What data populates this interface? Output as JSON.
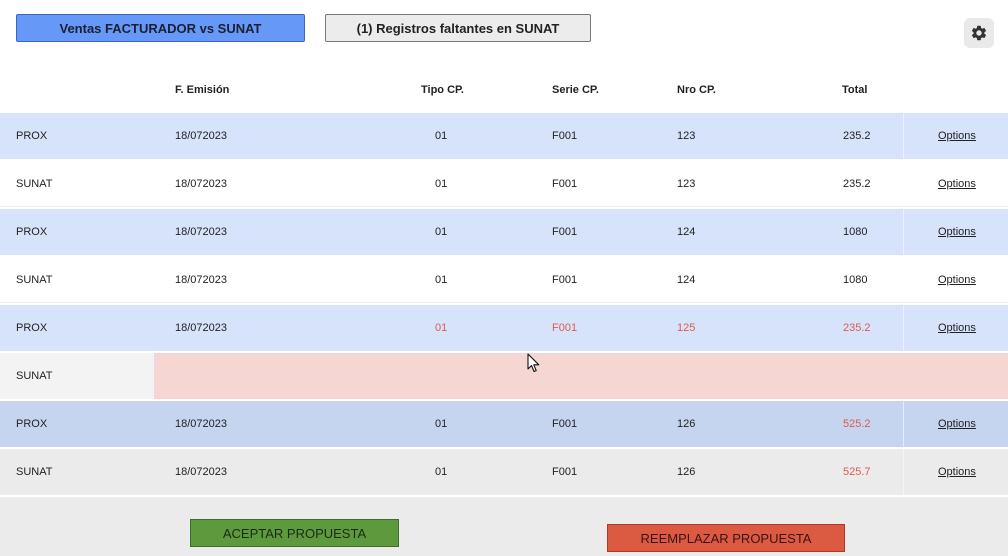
{
  "tabs": {
    "active_label": "Ventas FACTURADOR vs SUNAT",
    "missing_label": "(1) Registros faltantes en SUNAT"
  },
  "settings_icon": "gear-icon",
  "columns": {
    "source": "",
    "fecha": "F. Emisión",
    "tipo": "Tipo CP.",
    "serie": "Serie CP.",
    "nro": "Nro CP.",
    "total": "Total",
    "options": ""
  },
  "rows": [
    {
      "source": "PROX",
      "fecha": "18/072023",
      "tipo": "01",
      "serie": "F001",
      "nro": "123",
      "total": "235.2",
      "options": "Options",
      "style": "blue",
      "red_fields": []
    },
    {
      "source": "SUNAT",
      "fecha": "18/072023",
      "tipo": "01",
      "serie": "F001",
      "nro": "123",
      "total": "235.2",
      "options": "Options",
      "style": "white",
      "red_fields": []
    },
    {
      "source": "PROX",
      "fecha": "18/072023",
      "tipo": "01",
      "serie": "F001",
      "nro": "124",
      "total": "1080",
      "options": "Options",
      "style": "blue",
      "red_fields": []
    },
    {
      "source": "SUNAT",
      "fecha": "18/072023",
      "tipo": "01",
      "serie": "F001",
      "nro": "124",
      "total": "1080",
      "options": "Options",
      "style": "white",
      "red_fields": []
    },
    {
      "source": "PROX",
      "fecha": "18/072023",
      "tipo": "01",
      "serie": "F001",
      "nro": "125",
      "total": "235.2",
      "options": "Options",
      "style": "blue",
      "red_fields": [
        "tipo",
        "serie",
        "nro",
        "total"
      ]
    },
    {
      "source": "SUNAT",
      "fecha": "",
      "tipo": "",
      "serie": "",
      "nro": "",
      "total": "",
      "options": "",
      "style": "missing",
      "red_fields": []
    },
    {
      "source": "PROX",
      "fecha": "18/072023",
      "tipo": "01",
      "serie": "F001",
      "nro": "126",
      "total": "525.2",
      "options": "Options",
      "style": "blue-dark",
      "red_fields": [
        "total"
      ]
    },
    {
      "source": "SUNAT",
      "fecha": "18/072023",
      "tipo": "01",
      "serie": "F001",
      "nro": "126",
      "total": "525.7",
      "options": "Options",
      "style": "grey",
      "red_fields": [
        "total"
      ]
    }
  ],
  "buttons": {
    "accept": "ACEPTAR PROPUESTA",
    "replace": "REEMPLAZAR PROPUESTA"
  },
  "colors": {
    "tab_active": "#6699f7",
    "accept": "#5c9a3d",
    "replace": "#dd5a42",
    "mismatch_text": "#e05a4c",
    "missing_row": "#f6d6d3"
  }
}
